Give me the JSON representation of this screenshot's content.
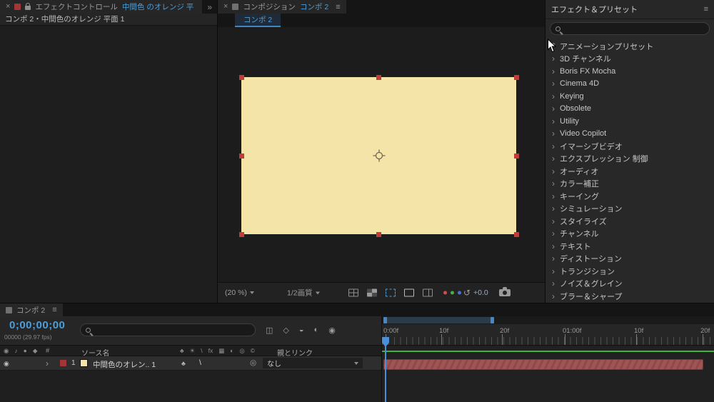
{
  "colors": {
    "accent_blue": "#4f9ed9",
    "timecode_blue": "#4b9fdd",
    "solid_fill": "#f5e4a7",
    "handle_red": "#c23b3b",
    "layer_bar_red": "#a15454",
    "cache_green": "#3db53a"
  },
  "effect_controls": {
    "close_label": "×",
    "title": "エフェクトコントロール",
    "target": "中間色 のオレンジ 平",
    "overflow": "»",
    "breadcrumb": "コンポ 2・中間色のオレンジ 平面 1"
  },
  "composition": {
    "close_label": "×",
    "title": "コンポジション",
    "target": "コンポ 2",
    "menu": "≡",
    "viewer_tab": "コンポ 2",
    "toolbar": {
      "zoom": "(20 %)",
      "resolution": "1/2画質",
      "reset": "↺",
      "exposure": "+0.0"
    }
  },
  "effects_presets": {
    "title": "エフェクト＆プリセット",
    "menu": "≡",
    "items": [
      {
        "prefix": "*",
        "label": "アニメーションプリセット"
      },
      {
        "prefix": "›",
        "label": "3D チャンネル"
      },
      {
        "prefix": "›",
        "label": "Boris FX Mocha"
      },
      {
        "prefix": "›",
        "label": "Cinema 4D"
      },
      {
        "prefix": "›",
        "label": "Keying"
      },
      {
        "prefix": "›",
        "label": "Obsolete"
      },
      {
        "prefix": "›",
        "label": "Utility"
      },
      {
        "prefix": "›",
        "label": "Video Copilot"
      },
      {
        "prefix": "›",
        "label": "イマーシブビデオ"
      },
      {
        "prefix": "›",
        "label": "エクスプレッション 制御"
      },
      {
        "prefix": "›",
        "label": "オーディオ"
      },
      {
        "prefix": "›",
        "label": "カラー補正"
      },
      {
        "prefix": "›",
        "label": "キーイング"
      },
      {
        "prefix": "›",
        "label": "シミュレーション"
      },
      {
        "prefix": "›",
        "label": "スタイライズ"
      },
      {
        "prefix": "›",
        "label": "チャンネル"
      },
      {
        "prefix": "›",
        "label": "テキスト"
      },
      {
        "prefix": "›",
        "label": "ディストーション"
      },
      {
        "prefix": "›",
        "label": "トランジション"
      },
      {
        "prefix": "›",
        "label": "ノイズ＆グレイン"
      },
      {
        "prefix": "›",
        "label": "ブラー＆シャープ"
      }
    ]
  },
  "timeline": {
    "tab_title": "コンポ 2",
    "menu": "≡",
    "timecode": "0;00;00;00",
    "frame_info": "00000 (29.97 fps)",
    "headers": {
      "number": "#",
      "source_name": "ソース名",
      "parent_link": "親とリンク"
    },
    "header_icons": [
      "◉",
      "♪",
      "●",
      "◆"
    ],
    "switch_icons": [
      "♣",
      "☀",
      "\\",
      "fx",
      "▦",
      "◐",
      "◎",
      "©"
    ],
    "button_icons": [
      "◫",
      "◇",
      "◒",
      "◐",
      "◉"
    ],
    "layer": {
      "eye": "◉",
      "expander": "›",
      "number": "1",
      "name": "中間色のオレン.. 1",
      "shy": "♣",
      "quality": "\\",
      "pickwhip": "◎",
      "parent_value": "なし"
    },
    "ruler_labels": [
      "0:00f",
      "10f",
      "20f",
      "01:00f",
      "10f",
      "20f"
    ]
  }
}
